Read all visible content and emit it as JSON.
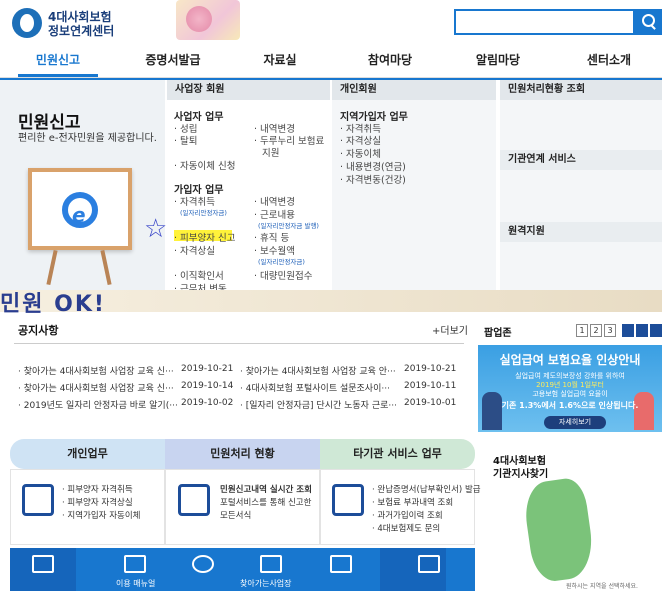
{
  "header": {
    "logo_line1": "4대사회보험",
    "logo_line2": "정보연계센터",
    "search_placeholder": ""
  },
  "nav": {
    "items": [
      "민원신고",
      "증명서발급",
      "자료실",
      "참여마당",
      "알림마당",
      "센터소개"
    ]
  },
  "mega": {
    "title": "민원신고",
    "desc": "편리한 e-전자민원을 제공합니다.",
    "col_workplace": "사업장 회원",
    "col_individual": "개인회원",
    "col_status": "민원처리현황 조회",
    "col_agency": "기관연계 서비스",
    "col_remote": "원격지원",
    "biz_head": "사업자 업무",
    "biz_left": [
      "· 성립",
      "· 탈퇴",
      "· 자동이체 신청"
    ],
    "biz_right": [
      "· 내역변경",
      "· 두루누리 보험료",
      "지원"
    ],
    "sub_head": "가입자 업무",
    "sub_left": [
      "· 자격취득",
      "· 피부양자 신고",
      "· 자격상실",
      "· 이직확인서",
      "· 근무처 변동"
    ],
    "sub_left_note": "(일자리안정자금)",
    "sub_right": [
      "· 내역변경",
      "· 근로내용",
      "· 휴직 등",
      "· 보수월액",
      "· 대량민원접수"
    ],
    "sub_right_note1": "(일자리안정자금 발행)",
    "sub_right_note2": "(일자리안정자금)",
    "ind_head": "지역가입자 업무",
    "ind_items": [
      "· 자격취득",
      "· 자격상실",
      "· 자동이체",
      "· 내용변경(연금)",
      "· 자격변동(건강)"
    ]
  },
  "band": {
    "text": "민원 OK!"
  },
  "notice": {
    "title": "공지사항",
    "more": "+더보기",
    "rows": [
      {
        "t1": "· 찾아가는 4대사회보험 사업장 교육 신···",
        "d1": "2019-10-21",
        "t2": "· 찾아가는 4대사회보험 사업장 교육 안···",
        "d2": "2019-10-21"
      },
      {
        "t1": "· 찾아가는 4대사회보험 사업장 교육 신···",
        "d1": "2019-10-14",
        "t2": "· 4대사회보험 포털사이트 설문조사이···",
        "d2": "2019-10-11"
      },
      {
        "t1": "· 2019년도 일자리 안정자금 바로 알기(···",
        "d1": "2019-10-02",
        "t2": "· [일자리 안정자금] 단시간 노동자 근로···",
        "d2": "2019-10-01"
      }
    ]
  },
  "popup": {
    "title": "팝업존",
    "pages": [
      "1",
      "2",
      "3"
    ],
    "headline": "실업급여 보험요율 인상안내",
    "line1": "실업급여 제도의보장성 강화를 위하여",
    "line2": "2019년 10월 1일부터",
    "line3": "고용보험 실업급여 요율이",
    "line4": "기존 1.3%에서 1.6%으로 인상됩니다.",
    "button": "자세히보기"
  },
  "tabs": [
    {
      "label": "개인업무",
      "items": [
        "· 피부양자 자격취득",
        "· 피부양자 자격상실",
        "· 지역가입자 자동이체"
      ]
    },
    {
      "label": "민원처리 현황",
      "title": "민원신고내역 실시간 조회",
      "desc1": "포털서비스를 통해 신고한",
      "desc2": "모든서식"
    },
    {
      "label": "타기관 서비스 업무",
      "items": [
        "· 완납증명서(납부확인서) 발급",
        "· 보험료 부과내역 조회",
        "· 과거가입이력 조회",
        "· 4대보험제도 문의"
      ]
    }
  ],
  "office": {
    "title1": "4대사회보험",
    "title2": "기관지사찾기",
    "note": "원하시는 지역을 선택하세요."
  },
  "bottom": {
    "labels": [
      "",
      "이용 매뉴얼",
      "",
      "찾아가는사업장",
      "",
      ""
    ]
  },
  "colors": {
    "accent": "#1877cf",
    "tab1": "#cfe3f4",
    "tab2": "#c8d4f0",
    "tab3": "#cfe8d6",
    "map": "#7bc37a"
  }
}
